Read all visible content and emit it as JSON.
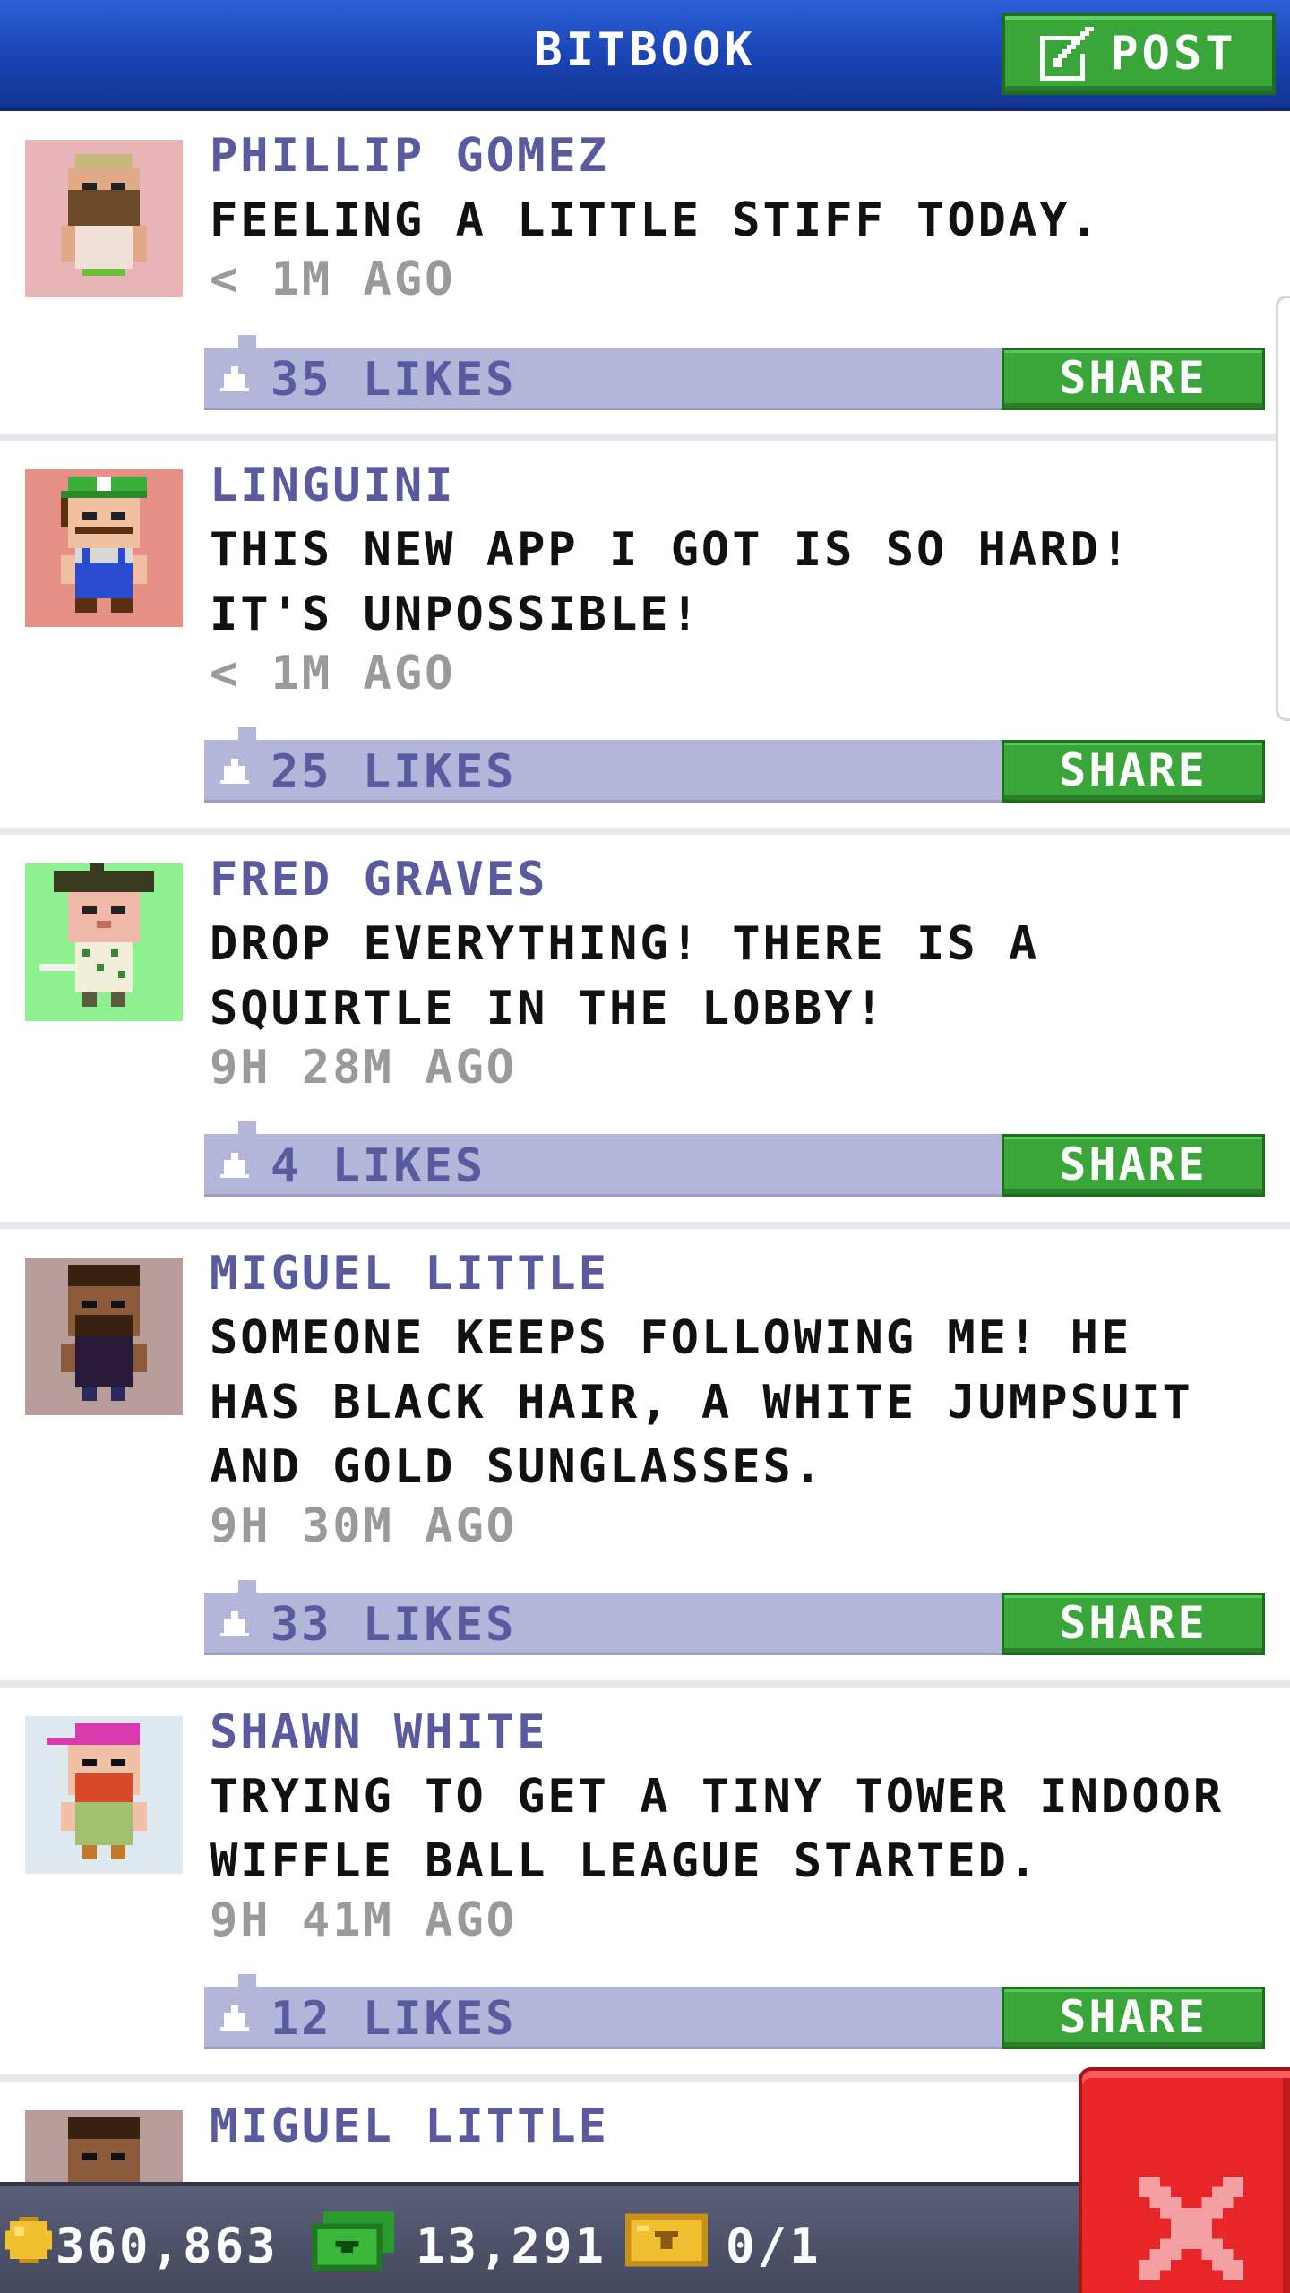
{
  "header": {
    "title": "BITBOOK",
    "post_label": "POST"
  },
  "posts": [
    {
      "author": "PHILLIP GOMEZ",
      "message": "FEELING A LITTLE STIFF TODAY.",
      "time": "< 1M AGO",
      "likes": "35 LIKES",
      "share_label": "SHARE",
      "avatar_bg": "#e8b4b8"
    },
    {
      "author": "LINGUINI",
      "message": "THIS NEW APP I GOT IS SO HARD! IT'S UNPOSSIBLE!",
      "time": "< 1M AGO",
      "likes": "25 LIKES",
      "share_label": "SHARE",
      "avatar_bg": "#e69088"
    },
    {
      "author": "FRED GRAVES",
      "message": "DROP EVERYTHING! THERE IS A SQUIRTLE IN THE LOBBY!",
      "time": "9H 28M AGO",
      "likes": "4 LIKES",
      "share_label": "SHARE",
      "avatar_bg": "#8ef08e"
    },
    {
      "author": "MIGUEL LITTLE",
      "message": "SOMEONE KEEPS FOLLOWING ME! HE HAS BLACK HAIR, A WHITE JUMPSUIT AND GOLD SUNGLASSES.",
      "time": "9H 30M AGO",
      "likes": "33 LIKES",
      "share_label": "SHARE",
      "avatar_bg": "#b89c9a"
    },
    {
      "author": "SHAWN WHITE",
      "message": "TRYING TO GET A TINY TOWER INDOOR WIFFLE BALL LEAGUE STARTED.",
      "time": "9H 41M AGO",
      "likes": "12 LIKES",
      "share_label": "SHARE",
      "avatar_bg": "#dfe8ee"
    },
    {
      "author": "MIGUEL LITTLE",
      "avatar_bg": "#b89c9a"
    }
  ],
  "status": {
    "coins": "360,863",
    "bux": "13,291",
    "vip": "0/1"
  },
  "colors": {
    "header_blue": "#1a43b3",
    "share_green": "#3aa63a",
    "likes_bar": "#b3b6d8",
    "author_purple": "#5a5aa0",
    "close_red": "#e8262a"
  },
  "icons": {
    "post": "edit-icon",
    "like": "thumbs-up-icon",
    "coin": "coin-icon",
    "bux": "bux-icon",
    "vip": "vip-ticket-icon",
    "close": "close-icon"
  }
}
